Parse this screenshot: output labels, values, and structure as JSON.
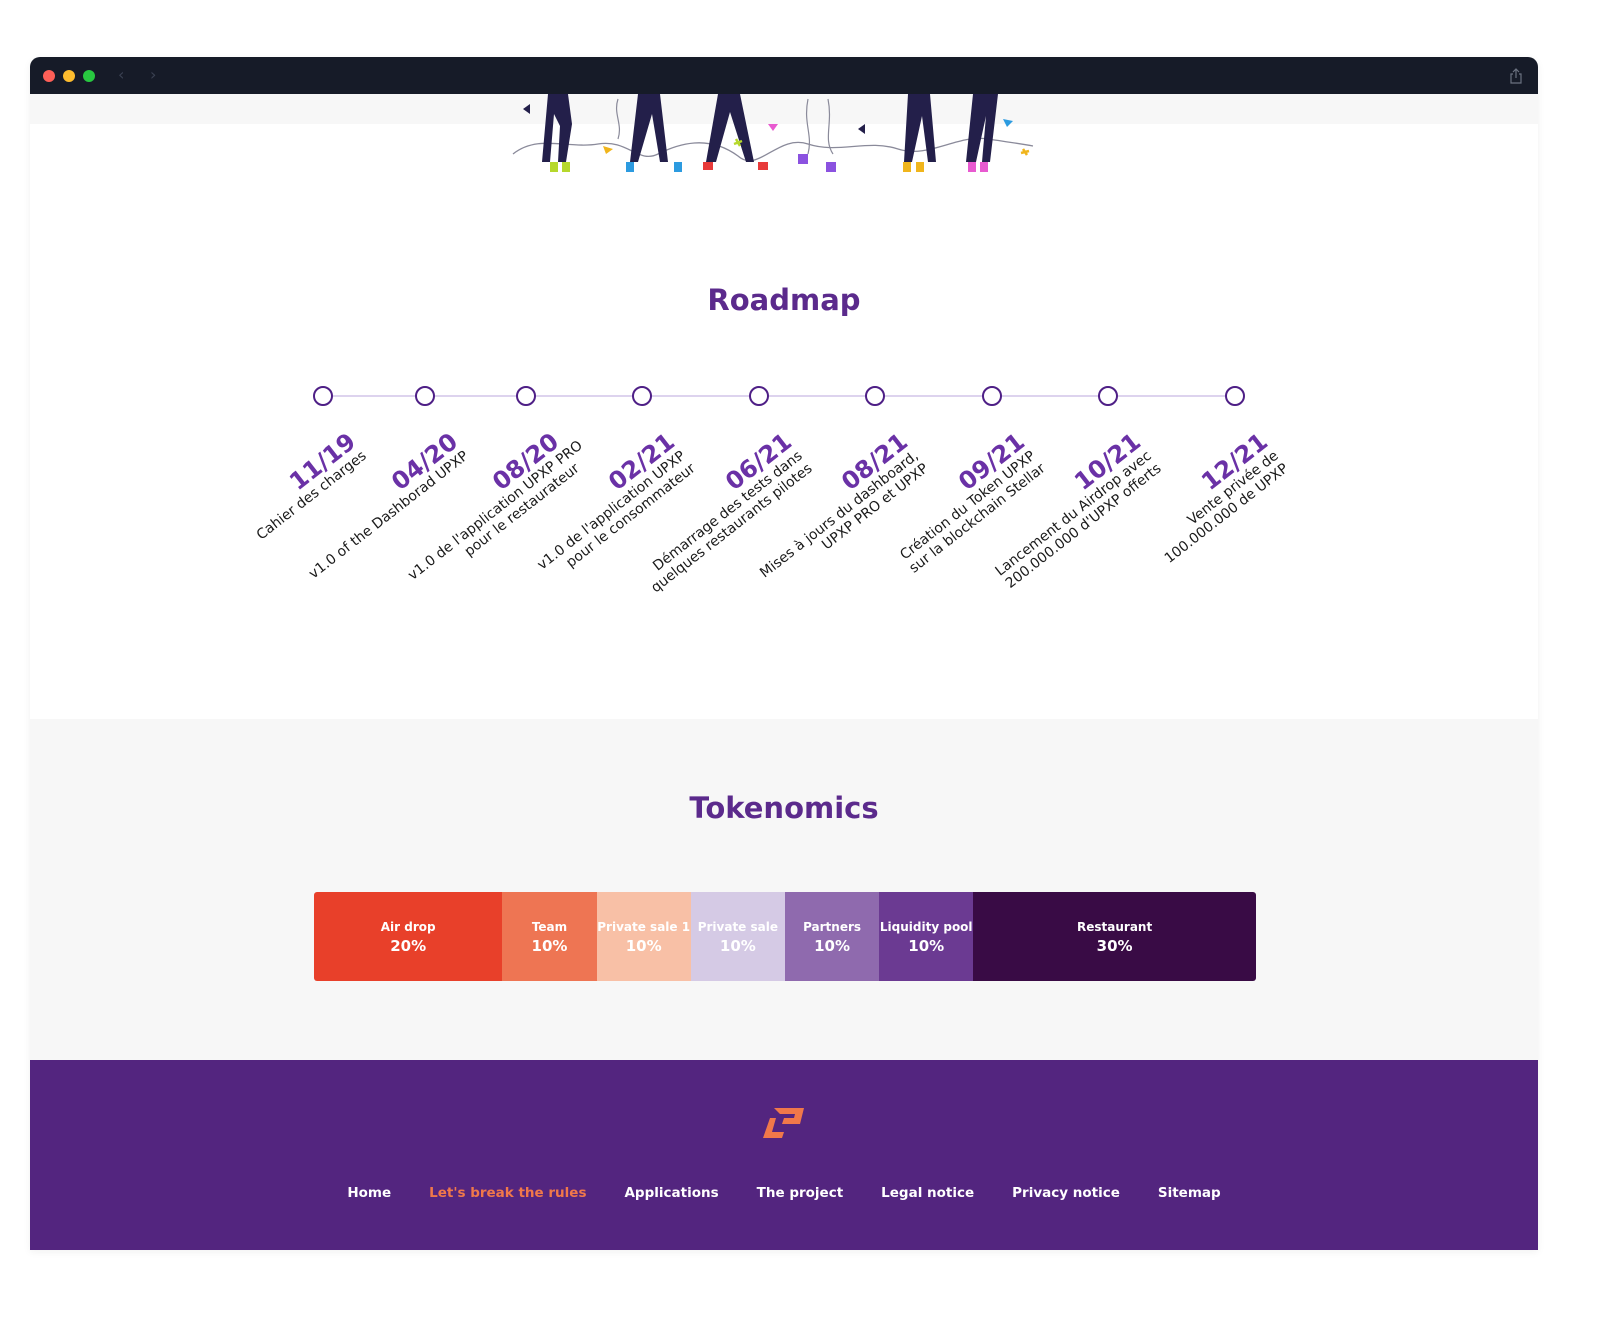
{
  "browser": {
    "back_icon": "‹",
    "forward_icon": "›"
  },
  "roadmap": {
    "title": "Roadmap",
    "milestones": [
      {
        "date": "11/19",
        "lines": [
          "Cahier des charges"
        ]
      },
      {
        "date": "04/20",
        "lines": [
          "v1.0 of the Dashborad UPXP"
        ]
      },
      {
        "date": "08/20",
        "lines": [
          "v1.0 de l'application UPXP PRO",
          "pour le restaurateur"
        ]
      },
      {
        "date": "02/21",
        "lines": [
          "v1.0 de l'application UPXP",
          "pour le consommateur"
        ]
      },
      {
        "date": "06/21",
        "lines": [
          "Démarrage des tests dans",
          "quelques restaurants pilotes"
        ]
      },
      {
        "date": "08/21",
        "lines": [
          "Mises à jours du dashboard,",
          "UPXP PRO et UPXP"
        ]
      },
      {
        "date": "09/21",
        "lines": [
          "Création du Token UPXP",
          "sur la blockchain Stellar"
        ]
      },
      {
        "date": "10/21",
        "lines": [
          "Lancement du Airdrop avec",
          "200.000.000 d'UPXP offerts"
        ]
      },
      {
        "date": "12/21",
        "lines": [
          "Vente privée de",
          "100.000.000 de UPXP"
        ]
      }
    ]
  },
  "tokenomics": {
    "title": "Tokenomics",
    "segments": [
      {
        "name": "Air drop",
        "label": "20%",
        "percent": 20,
        "color": "#e8402a",
        "text_color": "#ffffff"
      },
      {
        "name": "Team",
        "label": "10%",
        "percent": 10,
        "color": "#ee7553",
        "text_color": "#ffffff"
      },
      {
        "name": "Private sale 1",
        "label": "10%",
        "percent": 10,
        "color": "#f8c0a6",
        "text_color": "#ffffff"
      },
      {
        "name": "Private sale",
        "label": "10%",
        "percent": 10,
        "color": "#d5cae5",
        "text_color": "#ffffff"
      },
      {
        "name": "Partners",
        "label": "10%",
        "percent": 10,
        "color": "#8f6aae",
        "text_color": "#ffffff"
      },
      {
        "name": "Liquidity pool",
        "label": "10%",
        "percent": 10,
        "color": "#6b3a92",
        "text_color": "#ffffff"
      },
      {
        "name": "Restaurant",
        "label": "30%",
        "percent": 30,
        "color": "#390b45",
        "text_color": "#ffffff"
      }
    ]
  },
  "footer": {
    "links": [
      {
        "label": "Home",
        "active": false
      },
      {
        "label": "Let's break the rules",
        "active": true
      },
      {
        "label": "Applications",
        "active": false
      },
      {
        "label": "The project",
        "active": false
      },
      {
        "label": "Legal notice",
        "active": false
      },
      {
        "label": "Privacy notice",
        "active": false
      },
      {
        "label": "Sitemap",
        "active": false
      }
    ]
  },
  "colors": {
    "brand_purple": "#53257f",
    "heading_purple": "#5b2a8c",
    "accent_orange": "#f0784a"
  }
}
